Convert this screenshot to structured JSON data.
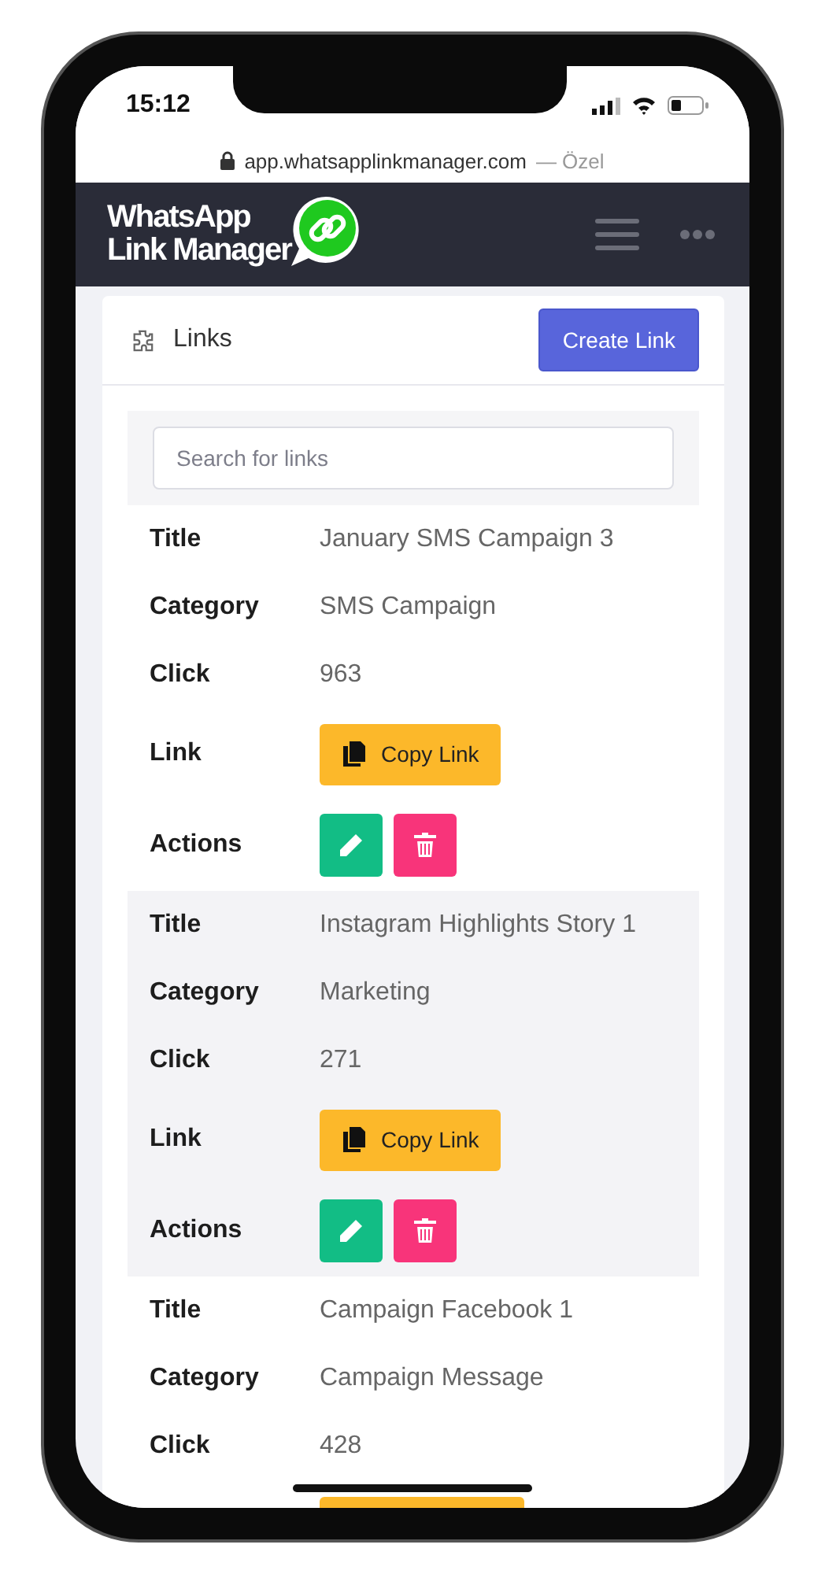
{
  "status_bar": {
    "time": "15:12"
  },
  "address_bar": {
    "url": "app.whatsapplinkmanager.com",
    "suffix": "— Özel"
  },
  "navbar": {
    "logo_lines": [
      "WhatsApp",
      "Link Manager"
    ]
  },
  "panel": {
    "title": "Links",
    "create_button": "Create Link",
    "search": {
      "placeholder": "Search for links"
    }
  },
  "links": [
    {
      "shaded": false,
      "fields": [
        {
          "kind": "text",
          "label": "Title",
          "value": "January SMS Campaign 3"
        },
        {
          "kind": "text",
          "label": "Category",
          "value": "SMS Campaign"
        },
        {
          "kind": "text",
          "label": "Click",
          "value": "963"
        },
        {
          "kind": "copy",
          "label": "Link",
          "value": "Copy Link"
        },
        {
          "kind": "actions",
          "label": "Actions"
        }
      ]
    },
    {
      "shaded": true,
      "fields": [
        {
          "kind": "text",
          "label": "Title",
          "value": "Instagram Highlights Story 1"
        },
        {
          "kind": "text",
          "label": "Category",
          "value": "Marketing"
        },
        {
          "kind": "text",
          "label": "Click",
          "value": "271"
        },
        {
          "kind": "copy",
          "label": "Link",
          "value": "Copy Link"
        },
        {
          "kind": "actions",
          "label": "Actions"
        }
      ]
    },
    {
      "shaded": false,
      "fields": [
        {
          "kind": "text",
          "label": "Title",
          "value": "Campaign Facebook 1"
        },
        {
          "kind": "text",
          "label": "Category",
          "value": "Campaign Message"
        },
        {
          "kind": "text",
          "label": "Click",
          "value": "428"
        },
        {
          "kind": "copy-cut"
        }
      ]
    }
  ]
}
